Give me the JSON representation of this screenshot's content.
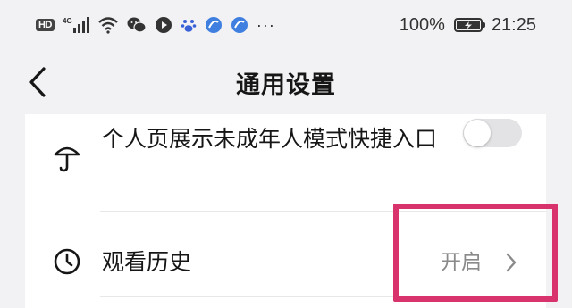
{
  "status_bar": {
    "hd": "HD",
    "network": "4G",
    "battery_percent": "100%",
    "time": "21:25",
    "more": "···"
  },
  "nav": {
    "title": "通用设置"
  },
  "settings": {
    "minor_mode": {
      "label": "个人页展示未成年人模式快捷入口",
      "toggle_on": false,
      "icon": "umbrella-icon"
    },
    "watch_history": {
      "label": "观看历史",
      "value": "开启",
      "icon": "clock-icon"
    }
  },
  "colors": {
    "highlight": "#d8336d",
    "value_text": "#8a8a8a",
    "toggle_off": "#e3e3e5"
  }
}
